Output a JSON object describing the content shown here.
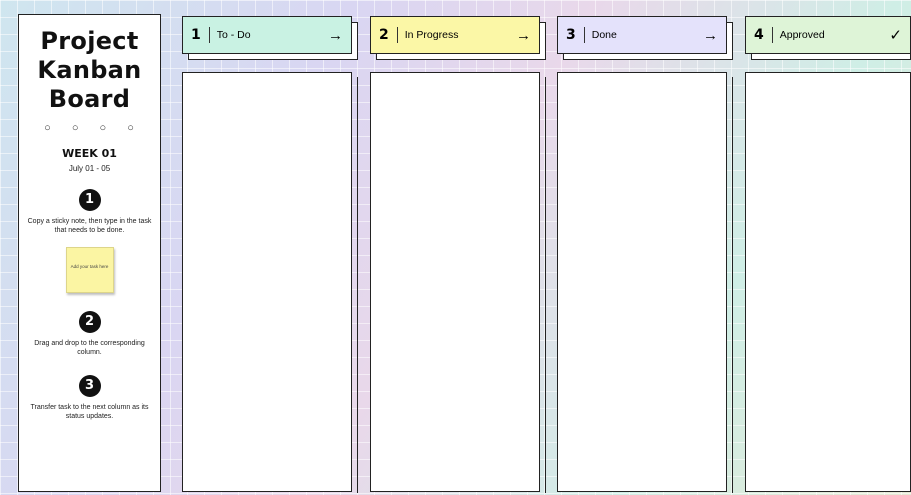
{
  "sidebar": {
    "title_line1": "Project",
    "title_line2": "Kanban",
    "title_line3": "Board",
    "dots": "○ ○ ○ ○",
    "week": "WEEK 01",
    "dates": "July 01 - 05",
    "steps": [
      {
        "num": "1",
        "text": "Copy a sticky note, then type in the task that needs to be done."
      },
      {
        "num": "2",
        "text": "Drag and drop to the corresponding column."
      },
      {
        "num": "3",
        "text": "Transfer task to the next column as its status updates."
      }
    ],
    "sticky_text": "Add your task here"
  },
  "columns": [
    {
      "num": "1",
      "label": "To - Do",
      "arrow": "→",
      "color": "#c9f2e3"
    },
    {
      "num": "2",
      "label": "In Progress",
      "arrow": "→",
      "color": "#fbf7a6"
    },
    {
      "num": "3",
      "label": "Done",
      "arrow": "→",
      "color": "#e4e2fb"
    },
    {
      "num": "4",
      "label": "Approved",
      "arrow": "✓",
      "color": "#def4d7"
    }
  ]
}
